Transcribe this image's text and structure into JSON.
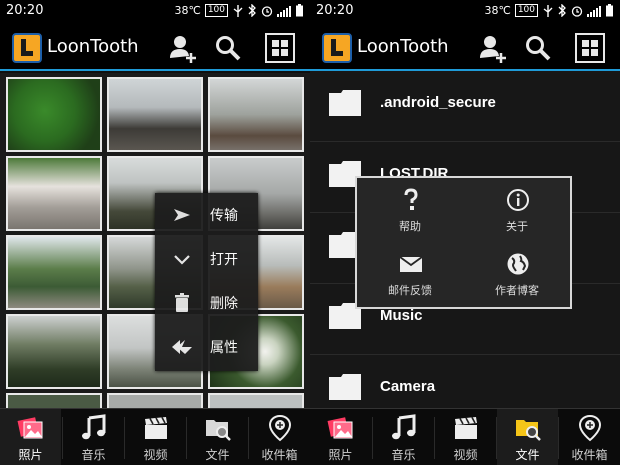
{
  "status_bar": {
    "time": "20:20",
    "temperature": "38℃",
    "battery": "100"
  },
  "app": {
    "title": "LoonTooth",
    "actions": [
      "add-user-icon",
      "search-icon",
      "grid-menu-icon"
    ],
    "accent_color": "#1f9bd8"
  },
  "left_pane": {
    "context_menu": {
      "items": [
        {
          "icon": "send-icon",
          "label": "传输"
        },
        {
          "icon": "chevron-down-icon",
          "label": "打开"
        },
        {
          "icon": "trash-icon",
          "label": "删除"
        },
        {
          "icon": "properties-icon",
          "label": "属性"
        }
      ]
    },
    "photos": [
      "green-tree",
      "misty-rocks",
      "foggy-trail",
      "plaza-umbrellas",
      "misty-peak",
      "foggy-crowd",
      "parked-bikes",
      "misty-valley",
      "tourists-road",
      "dark-trees",
      "foggy-hill",
      "white-flowers"
    ]
  },
  "right_pane": {
    "files": [
      {
        "name": ".android_secure"
      },
      {
        "name": "LOST.DIR"
      },
      {
        "name": ""
      },
      {
        "name": "Music"
      },
      {
        "name": "Camera"
      }
    ],
    "popup": {
      "items": [
        {
          "icon": "help-icon",
          "label": "帮助"
        },
        {
          "icon": "info-icon",
          "label": "关于"
        },
        {
          "icon": "mail-icon",
          "label": "邮件反馈"
        },
        {
          "icon": "globe-icon",
          "label": "作者博客"
        }
      ]
    }
  },
  "tabs": [
    {
      "icon": "photos-icon",
      "label": "照片"
    },
    {
      "icon": "music-icon",
      "label": "音乐"
    },
    {
      "icon": "video-icon",
      "label": "视频"
    },
    {
      "icon": "files-icon",
      "label": "文件"
    },
    {
      "icon": "inbox-icon",
      "label": "收件箱"
    }
  ],
  "active_tab_left": "照片",
  "active_tab_right": "文件"
}
